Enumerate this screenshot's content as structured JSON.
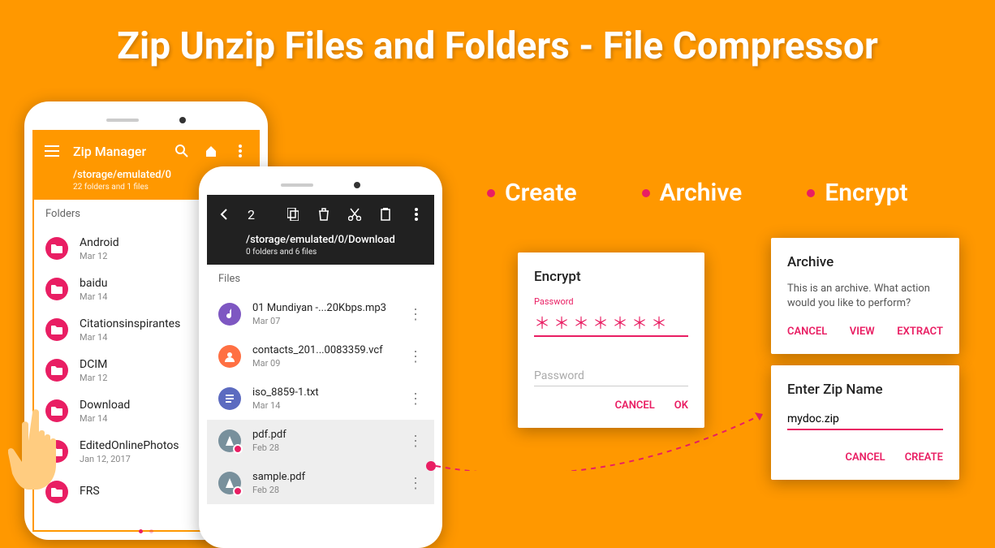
{
  "title": "Zip Unzip Files and Folders - File Compressor",
  "features": [
    "Create",
    "Archive",
    "Encrypt"
  ],
  "phone1": {
    "app_title": "Zip Manager",
    "path": "/storage/emulated/0",
    "subinfo": "22 folders and 1 files",
    "section": "Folders",
    "folders": [
      {
        "name": "Android",
        "date": "Mar 12"
      },
      {
        "name": "baidu",
        "date": "Mar 14"
      },
      {
        "name": "Citationsinspirantes",
        "date": "Mar 14"
      },
      {
        "name": "DCIM",
        "date": "Mar 12"
      },
      {
        "name": "Download",
        "date": "Mar 14"
      },
      {
        "name": "EditedOnlinePhotos",
        "date": "Jan 12, 2017"
      },
      {
        "name": "FRS",
        "date": ""
      }
    ]
  },
  "phone2": {
    "selection": "2",
    "path": "/storage/emulated/0/Download",
    "subinfo": "0 folders and 6 files",
    "section": "Files",
    "files": [
      {
        "name": "01 Mundiyan -...20Kbps.mp3",
        "date": "Mar 07",
        "icon": "music",
        "selected": false
      },
      {
        "name": "contacts_201...0083359.vcf",
        "date": "Mar 09",
        "icon": "contact",
        "selected": false
      },
      {
        "name": "iso_8859-1.txt",
        "date": "Mar 14",
        "icon": "text",
        "selected": false
      },
      {
        "name": "pdf.pdf",
        "date": "Feb 28",
        "icon": "pdf",
        "selected": true
      },
      {
        "name": "sample.pdf",
        "date": "Feb 28",
        "icon": "pdf",
        "selected": true
      }
    ]
  },
  "encrypt": {
    "title": "Encrypt",
    "label": "Password",
    "masked": "＊＊＊＊＊＊＊",
    "placeholder": "Password",
    "cancel": "CANCEL",
    "ok": "OK"
  },
  "archive": {
    "title": "Archive",
    "text": "This is an archive. What action would you like to perform?",
    "cancel": "CANCEL",
    "view": "VIEW",
    "extract": "EXTRACT"
  },
  "zipname": {
    "title": "Enter Zip Name",
    "value": "mydoc.zip",
    "cancel": "CANCEL",
    "create": "CREATE"
  }
}
